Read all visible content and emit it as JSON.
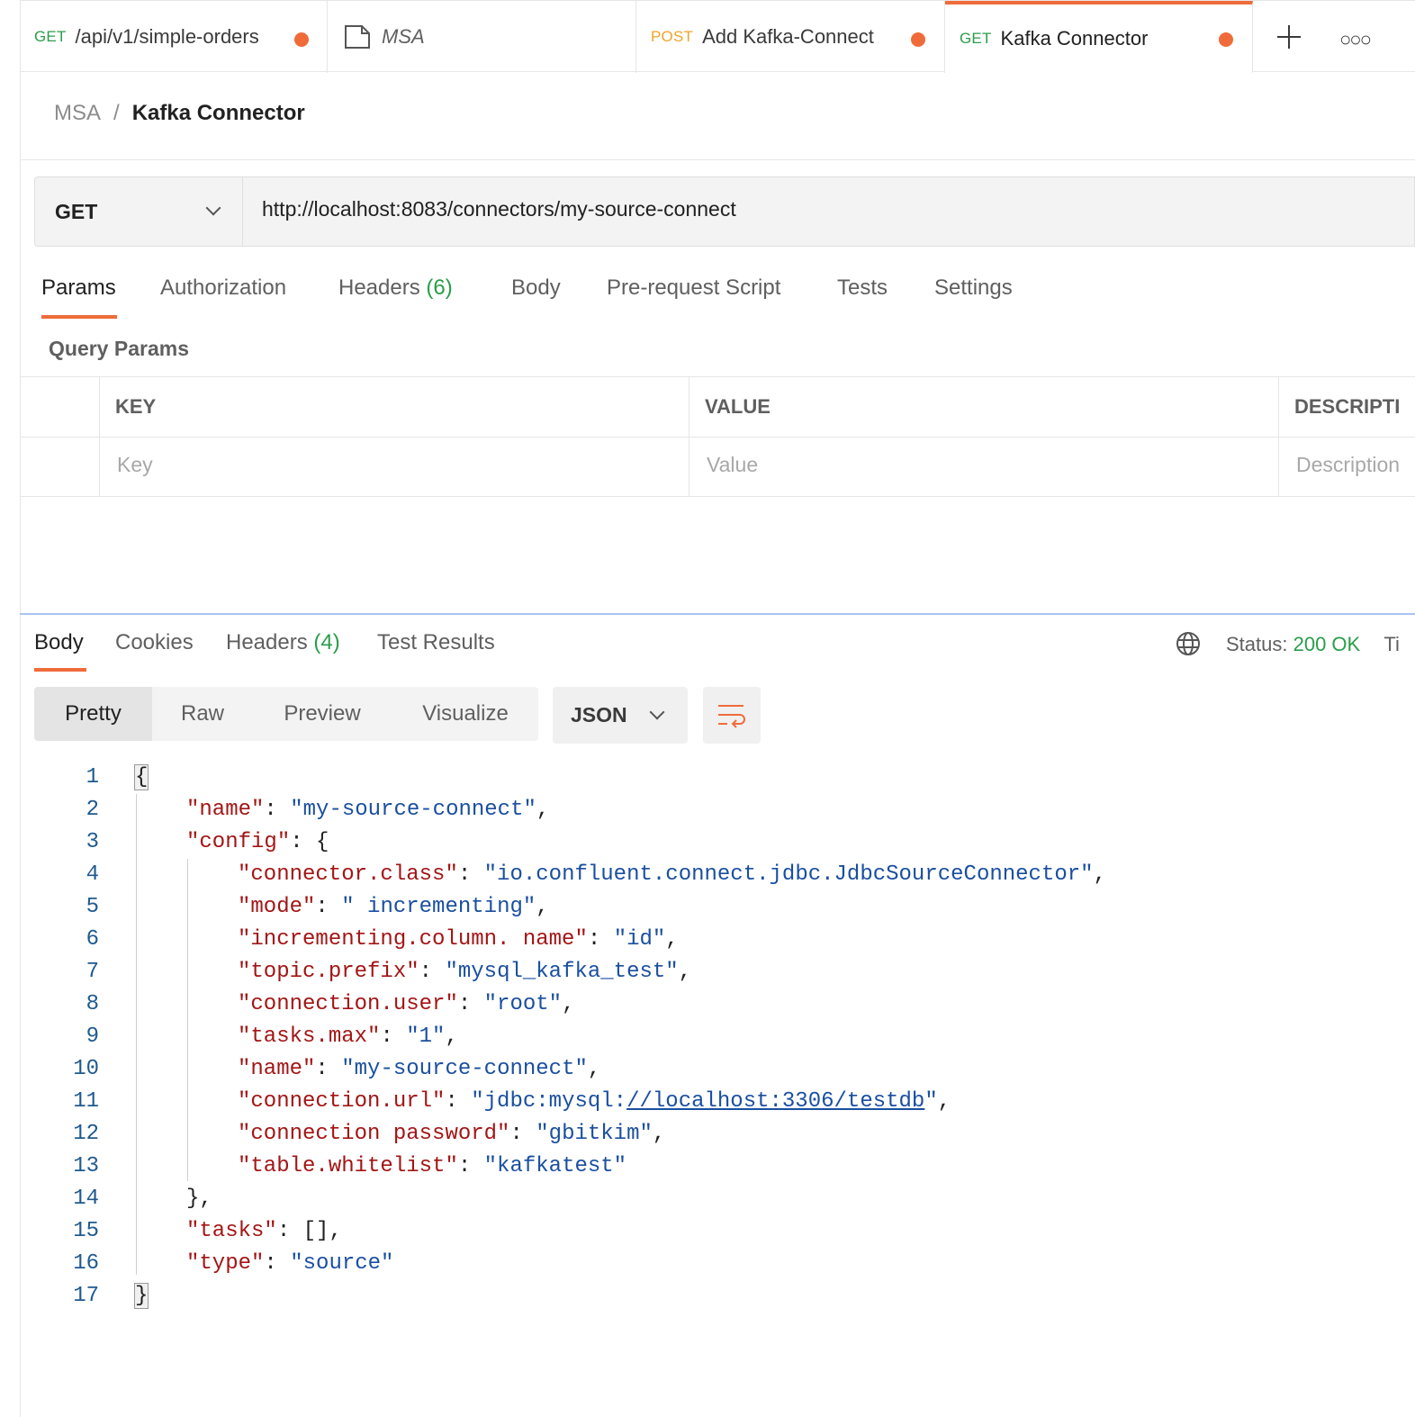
{
  "tabs": [
    {
      "method": "GET",
      "label": "/api/v1/simple-orders",
      "unsaved": true
    },
    {
      "method": "",
      "label": "MSA",
      "icon": "collection-icon"
    },
    {
      "method": "POST",
      "label": "Add Kafka-Connect",
      "unsaved": true
    },
    {
      "method": "GET",
      "label": "Kafka Connector",
      "unsaved": true,
      "active": true
    }
  ],
  "breadcrumb": {
    "parent": "MSA",
    "separator": "/",
    "current": "Kafka Connector"
  },
  "request": {
    "method": "GET",
    "url": "http://localhost:8083/connectors/my-source-connect"
  },
  "request_tabs": {
    "params": "Params",
    "authorization": "Authorization",
    "headers": "Headers",
    "headers_count": "(6)",
    "body": "Body",
    "prerequest": "Pre-request Script",
    "tests": "Tests",
    "settings": "Settings"
  },
  "query_params": {
    "title": "Query Params",
    "columns": [
      "KEY",
      "VALUE",
      "DESCRIPTI"
    ],
    "placeholders": [
      "Key",
      "Value",
      "Description"
    ]
  },
  "response": {
    "tabs": {
      "body": "Body",
      "cookies": "Cookies",
      "headers": "Headers",
      "headers_count": "(4)",
      "test_results": "Test Results"
    },
    "status_label": "Status:",
    "status_value": "200 OK",
    "time_label": "Ti",
    "formats": [
      "Pretty",
      "Raw",
      "Preview",
      "Visualize"
    ],
    "language": "JSON"
  },
  "code_lines": [
    "{",
    "\"name\": \"my-source-connect\",",
    "\"config\": {",
    "\"connector.class\": \"io.confluent.connect.jdbc.JdbcSourceConnector\",",
    "\"mode\": \" incrementing\",",
    "\"incrementing.column. name\": \"id\",",
    "\"topic.prefix\": \"mysql_kafka_test\",",
    "\"connection.user\": \"root\",",
    "\"tasks.max\": \"1\",",
    "\"name\": \"my-source-connect\",",
    "\"connection.url\": \"jdbc:mysql://localhost:3306/testdb\",",
    "\"connection password\": \"gbitkim\",",
    "\"table.whitelist\": \"kafkatest\"",
    "},",
    "\"tasks\": [],",
    "\"type\": \"source\"",
    "}"
  ],
  "colors": {
    "accent": "#ef6c3a",
    "get": "#2a9d4a",
    "post": "#f0a427",
    "key": "#a31515",
    "string": "#1a4fa0"
  }
}
